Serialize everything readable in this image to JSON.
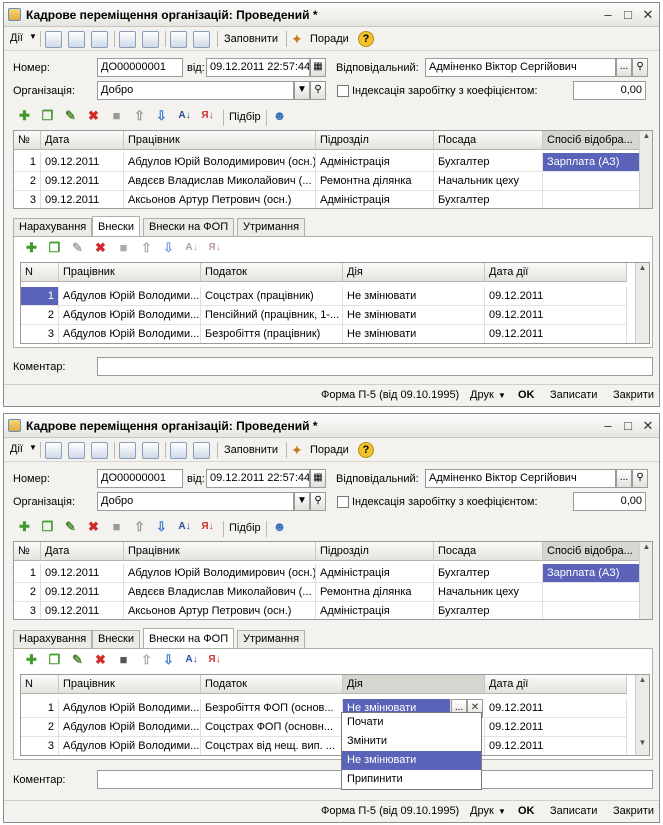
{
  "window": {
    "title": "Кадрове переміщення організацій: Проведений *"
  },
  "toolbar": {
    "actions": "Дії",
    "fill": "Заповнити",
    "tips": "Поради"
  },
  "header": {
    "number_label": "Номер:",
    "number": "ДО00000001",
    "date_label": "від:",
    "date": "09.12.2011 22:57:44",
    "responsible_label": "Відповідальний:",
    "responsible": "Адміненко Віктор Сергійович",
    "org_label": "Організація:",
    "org": "Добро",
    "index_label": "Індексація заробітку з коефіцієнтом:",
    "coef": "0,00"
  },
  "emp_toolbar": {
    "pick": "Підбір"
  },
  "employees": {
    "columns": [
      "№",
      "Дата",
      "Працівник",
      "Підрозділ",
      "Посада",
      "Спосіб відобра..."
    ],
    "rows": [
      {
        "n": "1",
        "date": "09.12.2011",
        "emp": "Абдулов Юрій Володимирович (осн.)",
        "dept": "Адміністрація",
        "pos": "Бухгалтер",
        "method": "Зарплата (АЗ)"
      },
      {
        "n": "2",
        "date": "09.12.2011",
        "emp": "Авдєєв Владислав Миколайович (...",
        "dept": "Ремонтна ділянка",
        "pos": "Начальник цеху",
        "method": ""
      },
      {
        "n": "3",
        "date": "09.12.2011",
        "emp": "Аксьонов Артур Петрович (осн.)",
        "dept": "Адміністрація",
        "pos": "Бухгалтер",
        "method": ""
      }
    ]
  },
  "tabs": [
    "Нарахування",
    "Внески",
    "Внески на ФОП",
    "Утримання"
  ],
  "contrib1": {
    "columns": [
      "N",
      "Працівник",
      "Податок",
      "Дія",
      "Дата дії"
    ],
    "rows": [
      {
        "n": "1",
        "emp": "Абдулов Юрій Володими...",
        "tax": "Соцстрах (працівник)",
        "action": "Не змінювати",
        "date": "09.12.2011"
      },
      {
        "n": "2",
        "emp": "Абдулов Юрій Володими...",
        "tax": "Пенсійний (працівник, 1-...",
        "action": "Не змінювати",
        "date": "09.12.2011"
      },
      {
        "n": "3",
        "emp": "Абдулов Юрій Володими...",
        "tax": "Безробіття (працівник)",
        "action": "Не змінювати",
        "date": "09.12.2011"
      }
    ]
  },
  "contrib2": {
    "columns": [
      "N",
      "Працівник",
      "Податок",
      "Дія",
      "Дата дії"
    ],
    "rows": [
      {
        "n": "1",
        "emp": "Абдулов Юрій Володими...",
        "tax": "Безробіття ФОП (основ...",
        "action": "Не змінювати",
        "date": "09.12.2011"
      },
      {
        "n": "2",
        "emp": "Абдулов Юрій Володими...",
        "tax": "Соцстрах ФОП (основн...",
        "action": "",
        "date": "09.12.2011"
      },
      {
        "n": "3",
        "emp": "Абдулов Юрій Володими...",
        "tax": "Соцстрах від нещ. вип. ...",
        "action": "",
        "date": "09.12.2011"
      }
    ]
  },
  "dropdown": {
    "options": [
      "Почати",
      "Змінити",
      "Не змінювати",
      "Припинити"
    ]
  },
  "comment_label": "Коментар:",
  "status": {
    "form": "Форма П-5 (від 09.10.1995)",
    "print": "Друк",
    "ok": "OK",
    "save": "Записати",
    "close": "Закрити"
  },
  "colors": {
    "selection": "#5a63b8",
    "add_icon": "#3f9a2b",
    "delete_icon": "#d12a2a"
  }
}
